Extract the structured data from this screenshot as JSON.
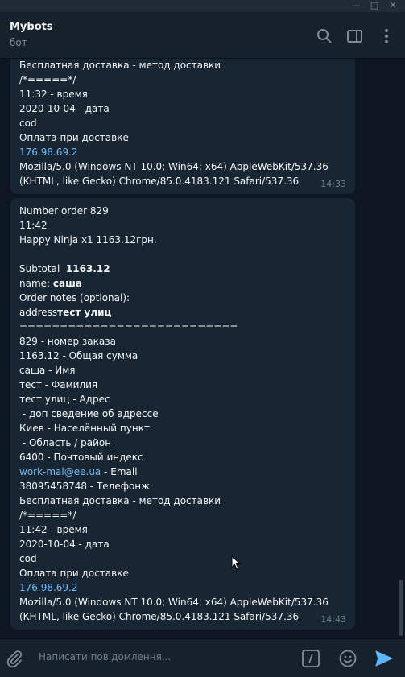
{
  "window": {
    "minimize": "—",
    "maximize": "□",
    "close": "✕"
  },
  "header": {
    "title": "Mybots",
    "subtitle": "бот",
    "icons": [
      "search-icon",
      "sidebar-toggle-icon",
      "more-vertical-icon"
    ]
  },
  "messages": [
    {
      "lines": [
        "Бесплатная доставка - метод доставки",
        "/*=====*/",
        "11:32 - время",
        "2020-10-04 - дата",
        "cod",
        "Оплата при доставке",
        "176.98.69.2",
        "Mozilla/5.0 (Windows NT 10.0; Win64; x64) AppleWebKit/537.36",
        "(KHTML, like Gecko) Chrome/85.0.4183.121 Safari/537.36"
      ],
      "time": "14:33"
    },
    {
      "lines": [
        "Number order 829",
        "11:42",
        "Happy Ninja x1 1163.12грн.",
        "",
        "Subtotal",
        "1163.12",
        "name:",
        "саша",
        "Order notes (optional):",
        "address",
        "тест улиц",
        "===========================",
        "829  - номер заказа",
        "1163.12 - Общая сумма",
        "саша - Имя",
        "тест - Фамилия",
        "тест улиц - Адрес",
        " - доп сведение об адрессе",
        "Киев - Населённый пункт",
        " - Область / район",
        "6400 - Почтовый индекс",
        "work-mal@ee.ua",
        " - Email",
        "38095458748 - Телефонж",
        "Бесплатная доставка - метод доставки",
        "/*=====*/",
        "11:42 - время",
        "2020-10-04 - дата",
        "cod",
        "Оплата при доставке",
        "176.98.69.2",
        "Mozilla/5.0 (Windows NT 10.0; Win64; x64) AppleWebKit/537.36",
        "(KHTML, like Gecko) Chrome/85.0.4183.121 Safari/537.36"
      ],
      "time": "14:43"
    }
  ],
  "composer": {
    "placeholder": "Написати повідомлення...",
    "icons": [
      "attach-icon",
      "bot-command-icon",
      "emoji-icon",
      "send-icon"
    ]
  },
  "colors": {
    "background": "#0e1621",
    "bubble": "#182533",
    "link": "#71baf5",
    "accent": "#5eb5f7"
  }
}
